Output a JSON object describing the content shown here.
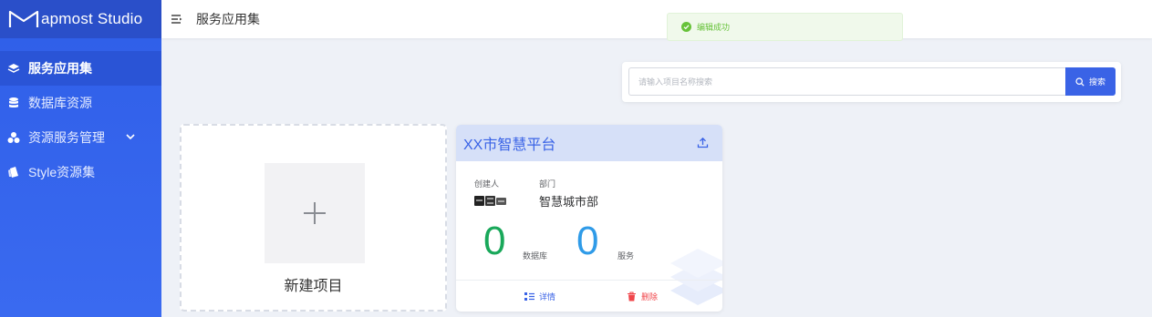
{
  "app": {
    "logo_text": "apmost Studio"
  },
  "sidebar": {
    "items": [
      {
        "label": "服务应用集",
        "icon": "layers-icon",
        "active": true
      },
      {
        "label": "数据库资源",
        "icon": "database-icon",
        "active": false
      },
      {
        "label": "资源服务管理",
        "icon": "cluster-icon",
        "active": false,
        "has_submenu": true
      },
      {
        "label": "Style资源集",
        "icon": "style-icon",
        "active": false
      }
    ]
  },
  "header": {
    "title": "服务应用集"
  },
  "toast": {
    "text": "编辑成功",
    "type": "success"
  },
  "search": {
    "placeholder": "请输入项目名称搜索",
    "value": "",
    "button_label": "搜索"
  },
  "new_project": {
    "label": "新建项目"
  },
  "project": {
    "title": "XX市智慧平台",
    "creator_label": "创建人",
    "creator_value": "詹**",
    "dept_label": "部门",
    "dept_value": "智慧城市部",
    "database_count": "0",
    "database_label": "数据库",
    "service_count": "0",
    "service_label": "服务",
    "detail_label": "详情",
    "delete_label": "删除"
  },
  "colors": {
    "brand": "#3a63e6",
    "success": "#67c23a",
    "db_count": "#19a85a",
    "service_count": "#2f9be8",
    "danger": "#f0454a"
  }
}
